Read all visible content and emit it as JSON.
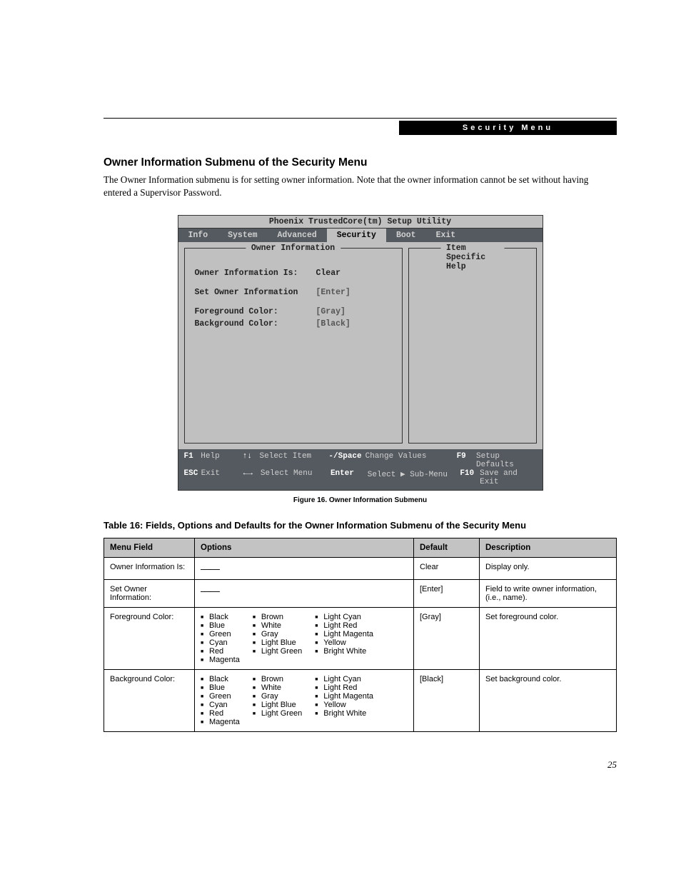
{
  "header": {
    "section_label": "Security Menu"
  },
  "section": {
    "title": "Owner Information Submenu of the Security Menu",
    "body": "The Owner Information submenu is for setting owner information. Note that the owner information cannot be set without having entered a Supervisor Password."
  },
  "bios": {
    "utility_title": "Phoenix TrustedCore(tm) Setup Utility",
    "tabs": [
      "Info",
      "System",
      "Advanced",
      "Security",
      "Boot",
      "Exit"
    ],
    "active_tab": "Security",
    "left_title": "Owner Information",
    "right_title": "Item Specific Help",
    "fields": {
      "owner_info_is": {
        "label": "Owner Information Is:",
        "value": "Clear"
      },
      "set_owner_info": {
        "label": "Set Owner Information",
        "value": "[Enter]"
      },
      "fg_color": {
        "label": "Foreground Color:",
        "value": "[Gray]"
      },
      "bg_color": {
        "label": "Background Color:",
        "value": "[Black]"
      }
    },
    "footer": {
      "r1": {
        "k1": "F1",
        "t1": "Help",
        "k2": "↑↓",
        "t2": "Select Item",
        "k3": "-/Space",
        "t3": "Change Values",
        "k4": "F9",
        "t4": "Setup Defaults"
      },
      "r2": {
        "k1": "ESC",
        "t1": "Exit",
        "k2": "←→",
        "t2": "Select Menu",
        "k3": "Enter",
        "t3": "Select ▶ Sub-Menu",
        "k4": "F10",
        "t4": "Save and Exit"
      }
    }
  },
  "figure_caption": "Figure 16.   Owner Information Submenu",
  "table_title": "Table 16: Fields, Options and Defaults for the Owner Information Submenu of the Security Menu",
  "table": {
    "headers": {
      "menu": "Menu Field",
      "options": "Options",
      "def": "Default",
      "desc": "Description"
    },
    "rows": [
      {
        "menu": "Owner Information Is:",
        "options_dash": true,
        "def": "Clear",
        "desc": "Display only."
      },
      {
        "menu": "Set Owner Information:",
        "options_dash": true,
        "def": "[Enter]",
        "desc": "Field to write owner information, (i.e., name)."
      },
      {
        "menu": "Foreground Color:",
        "options_cols": [
          [
            "Black",
            "Blue",
            "Green",
            "Cyan",
            "Red",
            "Magenta"
          ],
          [
            "Brown",
            "White",
            "Gray",
            "Light Blue",
            "Light Green"
          ],
          [
            "Light Cyan",
            "Light Red",
            "Light Magenta",
            "Yellow",
            "Bright White"
          ]
        ],
        "def": "[Gray]",
        "desc": "Set foreground color."
      },
      {
        "menu": "Background Color:",
        "options_cols": [
          [
            "Black",
            "Blue",
            "Green",
            "Cyan",
            "Red",
            "Magenta"
          ],
          [
            "Brown",
            "White",
            "Gray",
            "Light Blue",
            "Light Green"
          ],
          [
            "Light Cyan",
            "Light Red",
            "Light Magenta",
            "Yellow",
            "Bright White"
          ]
        ],
        "def": "[Black]",
        "desc": "Set background color."
      }
    ]
  },
  "page_number": "25"
}
